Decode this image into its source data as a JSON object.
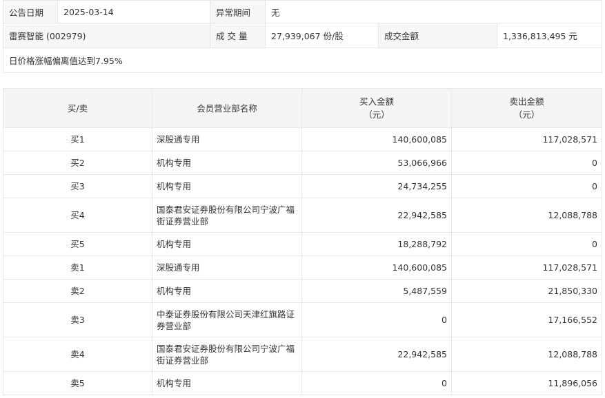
{
  "info": {
    "announce_date_label": "公告日期",
    "announce_date": "2025-03-14",
    "abnormal_period_label": "异常期间",
    "abnormal_period": "无",
    "stock": "雷赛智能 (002979)",
    "volume_label": "成 交 量",
    "volume": "27,939,067 份/股",
    "amount_label": "成交金额",
    "amount": "1,336,813,495 元",
    "reason": "日价格涨幅偏离值达到7.95%"
  },
  "headers": {
    "side": "买/卖",
    "dept": "会员营业部名称",
    "buy_line1": "买入金额",
    "buy_line2": "（元）",
    "sell_line1": "卖出金额",
    "sell_line2": "（元）"
  },
  "rows": [
    {
      "side": "买1",
      "dept": "深股通专用",
      "buy": "140,600,085",
      "sell": "117,028,571"
    },
    {
      "side": "买2",
      "dept": "机构专用",
      "buy": "53,066,966",
      "sell": "0"
    },
    {
      "side": "买3",
      "dept": "机构专用",
      "buy": "24,734,255",
      "sell": "0"
    },
    {
      "side": "买4",
      "dept": "国泰君安证券股份有限公司宁波广福街证券营业部",
      "buy": "22,942,585",
      "sell": "12,088,788"
    },
    {
      "side": "买5",
      "dept": "机构专用",
      "buy": "18,288,792",
      "sell": "0"
    },
    {
      "side": "卖1",
      "dept": "深股通专用",
      "buy": "140,600,085",
      "sell": "117,028,571"
    },
    {
      "side": "卖2",
      "dept": "机构专用",
      "buy": "5,487,559",
      "sell": "21,850,330"
    },
    {
      "side": "卖3",
      "dept": "中泰证券股份有限公司天津红旗路证券营业部",
      "buy": "0",
      "sell": "17,166,552"
    },
    {
      "side": "卖4",
      "dept": "国泰君安证券股份有限公司宁波广福街证券营业部",
      "buy": "22,942,585",
      "sell": "12,088,788"
    },
    {
      "side": "卖5",
      "dept": "机构专用",
      "buy": "0",
      "sell": "11,896,056"
    }
  ]
}
